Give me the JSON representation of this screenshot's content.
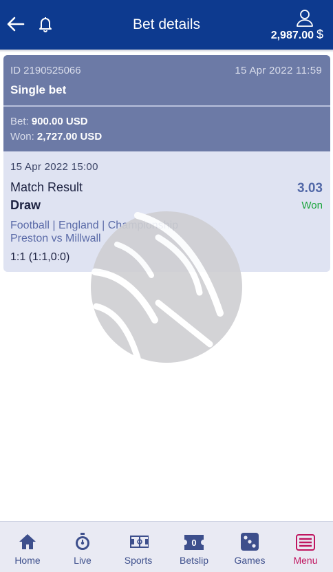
{
  "header": {
    "title": "Bet details",
    "balance": "2,987.00",
    "currency_symbol": "$"
  },
  "bet": {
    "id": "ID 2190525066",
    "placed_date": "15 Apr 2022 11:59",
    "type": "Single bet",
    "bet_label": "Bet:",
    "bet_amount": "900.00 USD",
    "won_label": "Won:",
    "won_amount": "2,727.00 USD"
  },
  "event": {
    "date": "15 Apr 2022 15:00",
    "market": "Match Result",
    "odds": "3.03",
    "selection": "Draw",
    "status": "Won",
    "league": "Football | England | Championship",
    "match": "Preston vs Millwall",
    "score": "1:1 (1:1,0:0)"
  },
  "nav": {
    "home": "Home",
    "live": "Live",
    "sports": "Sports",
    "betslip": "Betslip",
    "betslip_count": "0",
    "games": "Games",
    "menu": "Menu"
  },
  "colors": {
    "header_bg": "#0d3a8f",
    "card_header_bg": "#6c7aa6",
    "card_body_bg": "#dfe3f2",
    "won_green": "#1aa53c",
    "active_tab": "#c0155f",
    "nav_icon": "#3d4f8c"
  },
  "icons": [
    "back-arrow-icon",
    "bell-icon",
    "user-icon",
    "home-icon",
    "stopwatch-icon",
    "pitch-icon",
    "ticket-icon",
    "dice-icon",
    "menu-icon",
    "ball-watermark-icon"
  ]
}
